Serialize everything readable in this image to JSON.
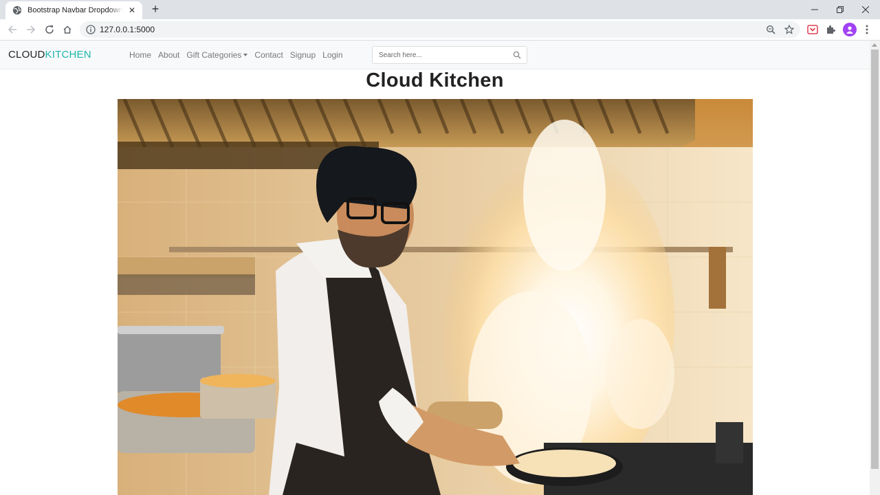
{
  "browser": {
    "tab_title": "Bootstrap Navbar Dropdown Logo",
    "url": "127.0.0.1:5000"
  },
  "navbar": {
    "brand_part1": "CLOUD",
    "brand_part2": "KITCHEN",
    "links": {
      "home": "Home",
      "about": "About",
      "gift_categories": "Gift Categories",
      "contact": "Contact",
      "signup": "Signup",
      "login": "Login"
    },
    "search_placeholder": "Search here...",
    "accent_color": "#1cb5ac"
  },
  "main": {
    "title": "Cloud Kitchen"
  }
}
